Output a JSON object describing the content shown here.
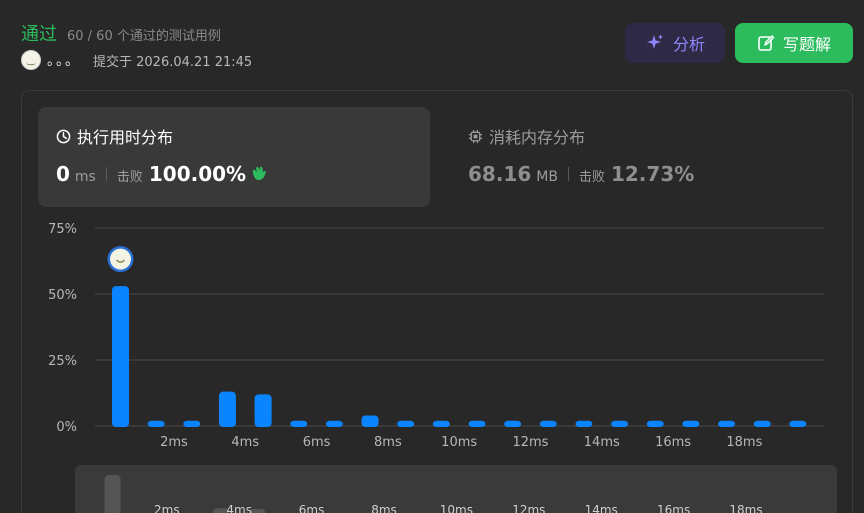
{
  "header": {
    "status": "通过",
    "tests": "60 / 60 个通过的测试用例",
    "user_name": "。。。",
    "submitted": "提交于 2026.04.21 21:45",
    "analyze_label": "分析",
    "solution_label": "写题解"
  },
  "metrics": {
    "runtime": {
      "title": "执行用时分布",
      "value": "0",
      "unit": "ms",
      "beats_label": "击败",
      "beats": "100.00%",
      "icon": "clock-icon"
    },
    "memory": {
      "title": "消耗内存分布",
      "value": "68.16",
      "unit": "MB",
      "beats_label": "击败",
      "beats": "12.73%",
      "icon": "chip-icon"
    }
  },
  "colors": {
    "accepted": "#2cbb5d",
    "bar": "#0a84ff",
    "analyze": "#8f86ff"
  },
  "chart_data": {
    "type": "bar",
    "y_ticks": [
      "75%",
      "50%",
      "25%",
      "0%"
    ],
    "ylim": [
      0,
      75
    ],
    "x_labels": [
      "2ms",
      "4ms",
      "6ms",
      "8ms",
      "10ms",
      "12ms",
      "14ms",
      "16ms",
      "18ms"
    ],
    "x_label_after_bar": [
      2,
      4,
      6,
      8,
      10,
      12,
      14,
      16,
      18
    ],
    "values": [
      53,
      2,
      2,
      13,
      12,
      2,
      2,
      4,
      2,
      2,
      2,
      2,
      2,
      2,
      2,
      2,
      2,
      2,
      2,
      2
    ],
    "highlight_index": 0
  },
  "mini_chart": {
    "labels": [
      "2ms",
      "4ms",
      "6ms",
      "8ms",
      "10ms",
      "12ms",
      "14ms",
      "16ms",
      "18ms"
    ]
  }
}
